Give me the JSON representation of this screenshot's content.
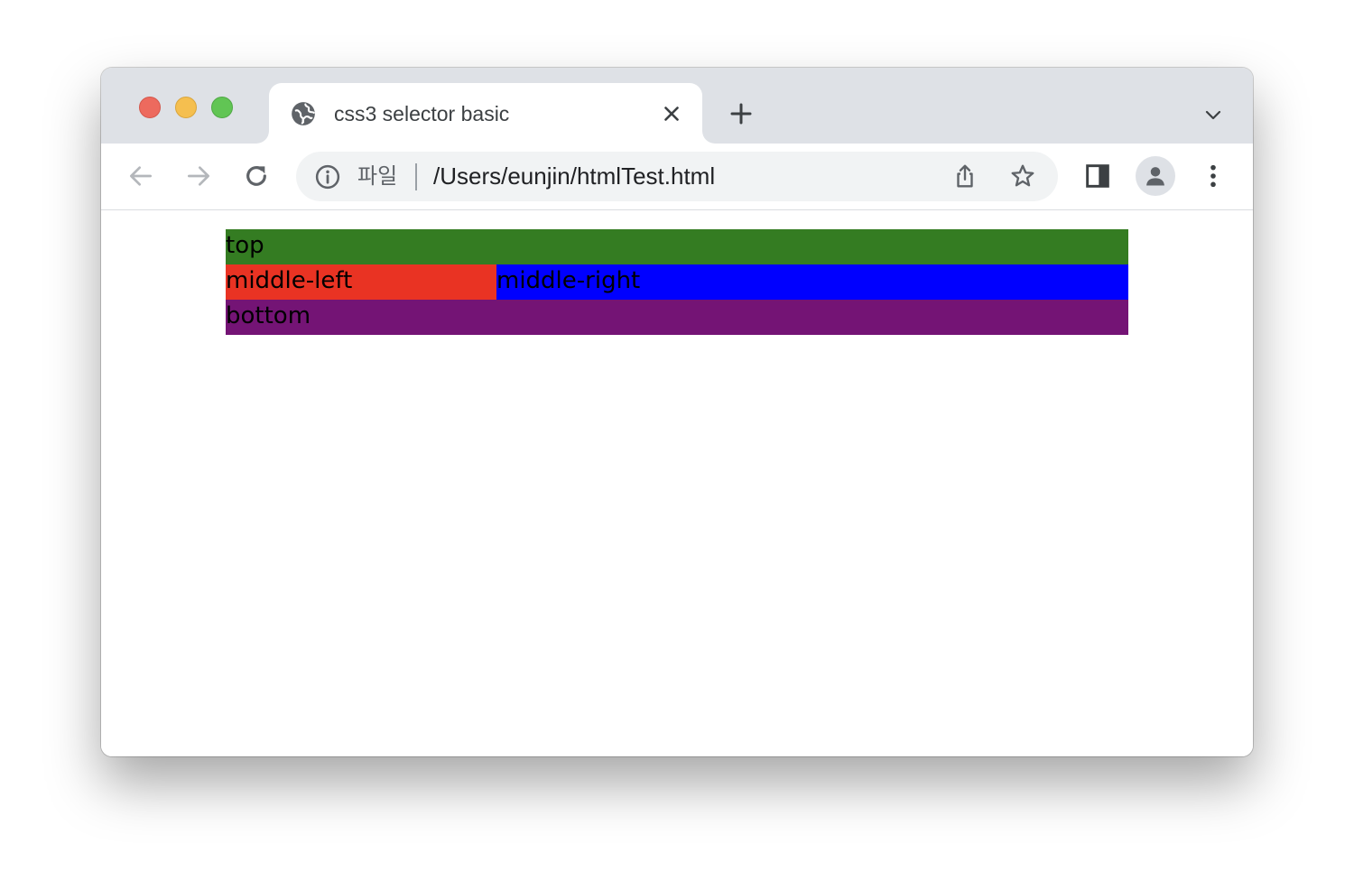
{
  "browser": {
    "tab": {
      "title": "css3 selector basic",
      "favicon": "globe-icon"
    },
    "address_bar": {
      "scheme_label": "파일",
      "url": "/Users/eunjin/htmlTest.html"
    }
  },
  "page": {
    "blocks": {
      "top": {
        "label": "top",
        "color": "#347C22"
      },
      "middle_left": {
        "label": "middle-left",
        "color": "#E93323"
      },
      "middle_right": {
        "label": "middle-right",
        "color": "#0000FF"
      },
      "bottom": {
        "label": "bottom",
        "color": "#741475"
      }
    }
  }
}
